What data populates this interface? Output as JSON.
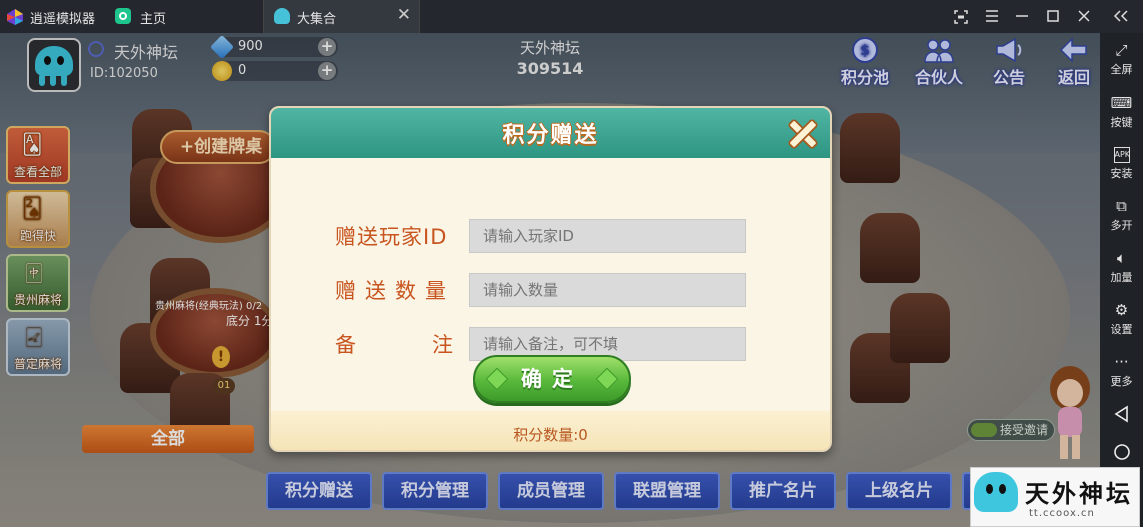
{
  "emulator": {
    "app_name": "逍遥模拟器",
    "tabs": [
      {
        "label": "主页",
        "icon": "home-app-icon"
      },
      {
        "label": "大集合",
        "icon": "octopus-game-icon"
      }
    ],
    "window_controls": [
      "screen-capture-icon",
      "menu-icon",
      "minimize-icon",
      "maximize-icon",
      "close-icon",
      "collapse-icon"
    ],
    "sidebar": [
      {
        "label": "全屏",
        "icon": "fullscreen-icon"
      },
      {
        "label": "按键",
        "icon": "keyboard-icon"
      },
      {
        "label": "安装",
        "icon": "apk-icon"
      },
      {
        "label": "多开",
        "icon": "multi-instance-icon"
      },
      {
        "label": "加量",
        "icon": "volume-up-icon"
      },
      {
        "label": "设置",
        "icon": "gear-icon"
      },
      {
        "label": "更多",
        "icon": "more-icon"
      }
    ]
  },
  "player": {
    "name": "天外神坛",
    "id": "ID:102050",
    "diamonds": "900",
    "coins": "0"
  },
  "club": {
    "name": "天外神坛",
    "id": "309514"
  },
  "header_buttons": [
    {
      "label": "积分池",
      "icon": "points-pool-icon"
    },
    {
      "label": "合伙人",
      "icon": "partners-icon"
    },
    {
      "label": "公告",
      "icon": "announcement-icon"
    },
    {
      "label": "返回",
      "icon": "back-icon"
    }
  ],
  "game_list": [
    {
      "label": "查看全部"
    },
    {
      "label": "跑得快"
    },
    {
      "label": "贵州麻将"
    },
    {
      "label": "普定麻将"
    }
  ],
  "lobby": {
    "create_table": "+创建牌桌",
    "all_button": "全部",
    "table_label": "贵州麻将(经典玩法) 0/2",
    "table_fee": "底分 1分",
    "seat_number": "01",
    "accept_invite": "接受邀请"
  },
  "bottom_tabs": [
    "积分赠送",
    "积分管理",
    "成员管理",
    "联盟管理",
    "推广名片",
    "上级名片"
  ],
  "dialog": {
    "title": "积分赠送",
    "fields": [
      {
        "label": "赠送玩家ID",
        "placeholder": "请输入玩家ID"
      },
      {
        "label": "赠送数量",
        "placeholder": "请输入数量"
      },
      {
        "label": "备注",
        "placeholder": "请输入备注，可不填"
      }
    ],
    "confirm": "确定",
    "points_label": "积分数量:0"
  },
  "watermark": {
    "text": "天外神坛",
    "url": "tt.ccoox.cn"
  },
  "colors": {
    "dialog_header": "#3fa894",
    "label_orange": "#c8551f",
    "confirm_green": "#58b83b",
    "tab_blue": "#2f4fb5"
  }
}
